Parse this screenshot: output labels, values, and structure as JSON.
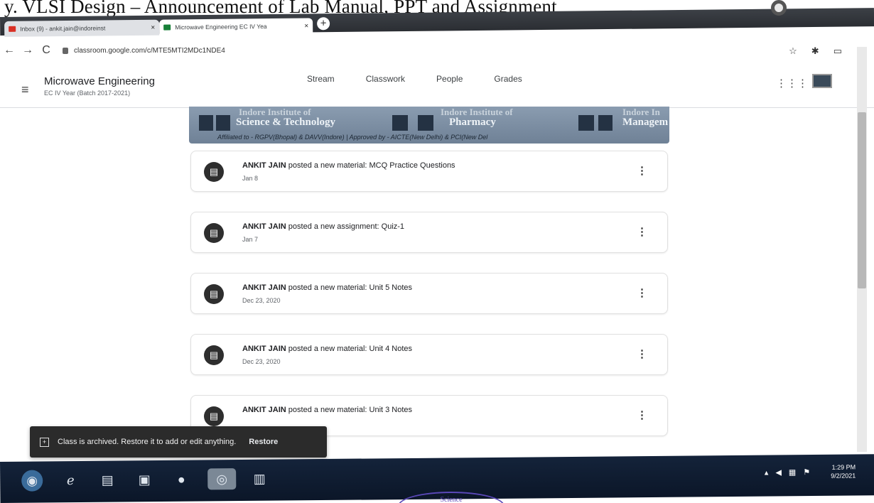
{
  "doc_heading": "y.  VLSI Design – Announcement of Lab Manual, PPT and Assignment",
  "browser": {
    "tabs": [
      {
        "label": "Inbox (9) - ankit.jain@indoreinst",
        "close": "×"
      },
      {
        "label": "Microwave Engineering EC IV Yea",
        "close": "×"
      }
    ],
    "new_tab": "+",
    "back": "←",
    "forward": "→",
    "reload": "C",
    "url": "classroom.google.com/c/MTE5MTI2MDc1NDE4",
    "star": "☆",
    "extension": "✱",
    "cast": "▭",
    "menu": "⋮",
    "window_controls": [
      "—",
      "□",
      "×"
    ]
  },
  "classroom": {
    "hamburger": "≡",
    "class_title": "Microwave Engineering",
    "class_subtitle": "EC IV Year (Batch 2017-2021)",
    "nav_tabs": [
      "Stream",
      "Classwork",
      "People",
      "Grades"
    ],
    "apps": "⋮⋮⋮"
  },
  "banner": {
    "line1": [
      "Science & Technology",
      "Pharmacy",
      "Managem"
    ],
    "line0": [
      "Indore Institute of",
      "Indore Institute of",
      "Indore In"
    ],
    "subline": "Affiliated to - RGPV(Bhopal) & DAVV(Indore) | Approved by - AICTE(New Delhi) & PCI(New Del"
  },
  "posts": [
    {
      "author": "ANKIT JAIN",
      "text": " posted a new material: MCQ Practice Questions",
      "date": "Jan 8"
    },
    {
      "author": "ANKIT JAIN",
      "text": " posted a new assignment: Quiz-1",
      "date": "Jan 7"
    },
    {
      "author": "ANKIT JAIN",
      "text": " posted a new material: Unit 5 Notes",
      "date": "Dec 23, 2020"
    },
    {
      "author": "ANKIT JAIN",
      "text": " posted a new material: Unit 4 Notes",
      "date": "Dec 23, 2020"
    },
    {
      "author": "ANKIT JAIN",
      "text": " posted a new material: Unit 3 Notes",
      "date": ""
    }
  ],
  "post_menu": "⋮",
  "snackbar": {
    "message": "Class is archived. Restore it to add or edit anything.",
    "action": "Restore"
  },
  "taskbar": {
    "time": "1:29 PM",
    "date": "9/2/2021"
  },
  "colors": {
    "snackbar_bg": "#2b2b2b",
    "taskbar_bg": "#14233a",
    "banner_bg": "#7d8fa4"
  }
}
